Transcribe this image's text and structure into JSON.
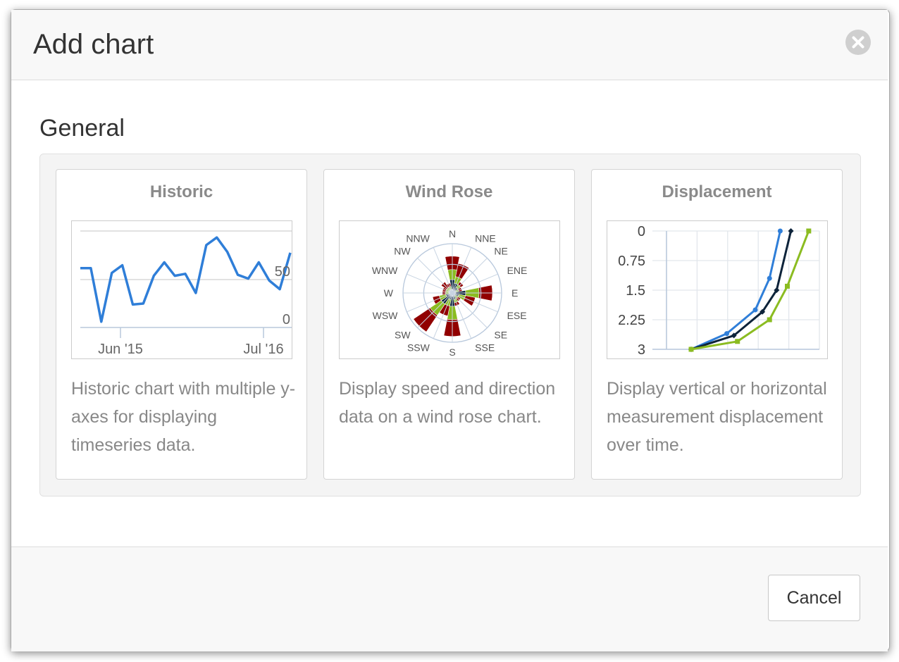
{
  "dialog": {
    "title": "Add chart",
    "close_icon": "close-circle-icon",
    "section_title": "General",
    "cancel_label": "Cancel"
  },
  "colors": {
    "blue": "#2f7ed8",
    "navy": "#0d233a",
    "green": "#8bbc21",
    "dark_red": "#910000"
  },
  "cards": [
    {
      "title": "Historic",
      "description": "Historic chart with multiple y-axes for displaying timeseries data."
    },
    {
      "title": "Wind Rose",
      "description": "Display speed and direction data on a wind rose chart."
    },
    {
      "title": "Displacement",
      "description": "Display vertical or horizontal measurement displacement over time."
    }
  ],
  "chart_data": [
    {
      "type": "line",
      "x_tick_labels": [
        "Jun '15",
        "Jul '16"
      ],
      "y_tick_labels": [
        "50",
        "0"
      ],
      "series": [
        {
          "values": [
            62,
            62,
            6,
            57,
            65,
            24,
            25,
            54,
            68,
            54,
            56,
            36,
            86,
            94,
            79,
            55,
            51,
            68,
            49,
            40,
            78
          ]
        }
      ]
    },
    {
      "type": "wind-rose",
      "direction_labels": [
        "N",
        "NNE",
        "NE",
        "ENE",
        "E",
        "ESE",
        "SE",
        "SSE",
        "S",
        "SSW",
        "SW",
        "WSW",
        "W",
        "WNW",
        "NW",
        "NNW"
      ],
      "series": [
        {
          "name": "",
          "values": [
            2,
            1.5,
            1,
            0.5,
            2,
            1,
            0.5,
            1,
            2,
            1,
            2,
            1,
            0.5,
            0.5,
            0.5,
            0.5
          ]
        },
        {
          "name": "",
          "values": [
            1.5,
            1,
            0.5,
            0.5,
            2,
            1,
            0.5,
            0.5,
            2,
            1,
            2,
            1,
            0.5,
            0.5,
            0.5,
            0.5
          ]
        },
        {
          "name": "",
          "values": [
            2,
            2,
            0.5,
            0.5,
            2,
            1.5,
            0.5,
            0.5,
            2.5,
            1.5,
            3,
            1,
            0.5,
            0.5,
            1,
            0.5
          ]
        }
      ]
    },
    {
      "type": "line",
      "y_tick_labels": [
        "0",
        "0.75",
        "1.5",
        "2.25",
        "3"
      ],
      "ylim": [
        0,
        3
      ],
      "series": [
        {
          "name": "",
          "points": [
            [
              0,
              3
            ],
            [
              1,
              2.6
            ],
            [
              1.8,
              2.0
            ],
            [
              2.2,
              1.2
            ],
            [
              2.5,
              0
            ]
          ]
        },
        {
          "name": "",
          "points": [
            [
              0,
              3
            ],
            [
              1.2,
              2.65
            ],
            [
              2.0,
              2.05
            ],
            [
              2.4,
              1.5
            ],
            [
              2.8,
              0
            ]
          ]
        },
        {
          "name": "",
          "points": [
            [
              0,
              3
            ],
            [
              1.3,
              2.8
            ],
            [
              2.2,
              2.25
            ],
            [
              2.7,
              1.4
            ],
            [
              3.3,
              0
            ]
          ]
        }
      ]
    }
  ]
}
